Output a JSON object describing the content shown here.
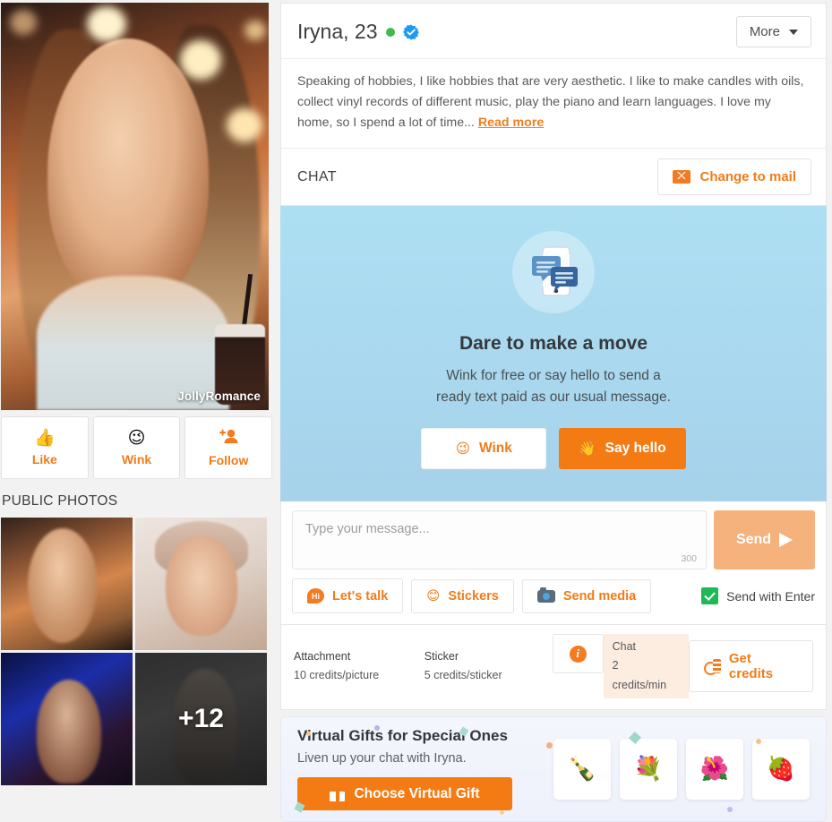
{
  "profile": {
    "name_age": "Iryna, 23",
    "online_status": "online",
    "verified_badge": "verified-check",
    "watermark": "JollyRomance",
    "more_label": "More",
    "about_text": "Speaking of hobbies, I like hobbies that are very aesthetic. I like to make candles with oils, collect vinyl records of different music, play the piano and learn languages. I love my home, so I spend a lot of time...",
    "read_more_label": "Read more"
  },
  "side_actions": [
    {
      "label": "Like",
      "icon": "thumbs-up-icon",
      "glyph": "👍"
    },
    {
      "label": "Wink",
      "icon": "wink-face-icon",
      "glyph": "😉"
    },
    {
      "label": "Follow",
      "icon": "person-add-icon",
      "glyph": "👤"
    }
  ],
  "photos": {
    "section_title": "PUBLIC PHOTOS",
    "more_count_label": "+12"
  },
  "chat": {
    "header_label": "CHAT",
    "change_to_mail_label": "Change to mail",
    "mail_icon": "envelope-icon"
  },
  "promo": {
    "icon": "phone-chat-icon",
    "title": "Dare to make a move",
    "subtitle_line1": "Wink for free or say hello to send a",
    "subtitle_line2": "ready text paid as our usual message.",
    "wink_label": "Wink",
    "wink_glyph": "😉",
    "hello_label": "Say hello",
    "hello_glyph": "👋"
  },
  "composer": {
    "placeholder": "Type your message...",
    "value": "",
    "char_limit": "300",
    "send_label": "Send",
    "send_icon": "paper-plane-icon",
    "quick_actions": [
      {
        "label": "Let's talk",
        "icon": "hi-bubble-icon",
        "glyph": "Hi"
      },
      {
        "label": "Stickers",
        "icon": "sticker-icon",
        "glyph": "😊"
      },
      {
        "label": "Send media",
        "icon": "camera-icon",
        "glyph": ""
      }
    ],
    "send_with_enter_label": "Send with Enter",
    "send_with_enter_checked": true
  },
  "credits": {
    "attachment_title": "Attachment",
    "attachment_rate": "10 credits/picture",
    "sticker_title": "Sticker",
    "sticker_rate": "5 credits/sticker",
    "chat_title": "Chat",
    "chat_rate": "2 credits/min",
    "info_icon": "info-icon",
    "get_credits_label": "Get credits",
    "coins_icon": "coins-icon"
  },
  "gifts": {
    "title": "Virtual Gifts for Special Ones",
    "subtitle": "Liven up your chat with Iryna.",
    "button_label": "Choose Virtual Gift",
    "button_icon": "gift-box-icon",
    "thumbs": [
      {
        "name": "perfume-bottle-gift",
        "glyph": "🍾"
      },
      {
        "name": "flower-bouquet-gift",
        "glyph": "💐"
      },
      {
        "name": "flower-basket-gift",
        "glyph": "🌺"
      },
      {
        "name": "strawberries-gift",
        "glyph": "🍓"
      }
    ]
  },
  "colors": {
    "accent_orange": "#f47b14",
    "accent_orange_text": "#f07c18",
    "promo_blue": "#a9d8ef",
    "online_green": "#3fb950",
    "verified_blue": "#1d9bf0",
    "check_green": "#1db954",
    "send_disabled": "#f5b27c",
    "chat_rate_bg": "#fdece0"
  }
}
